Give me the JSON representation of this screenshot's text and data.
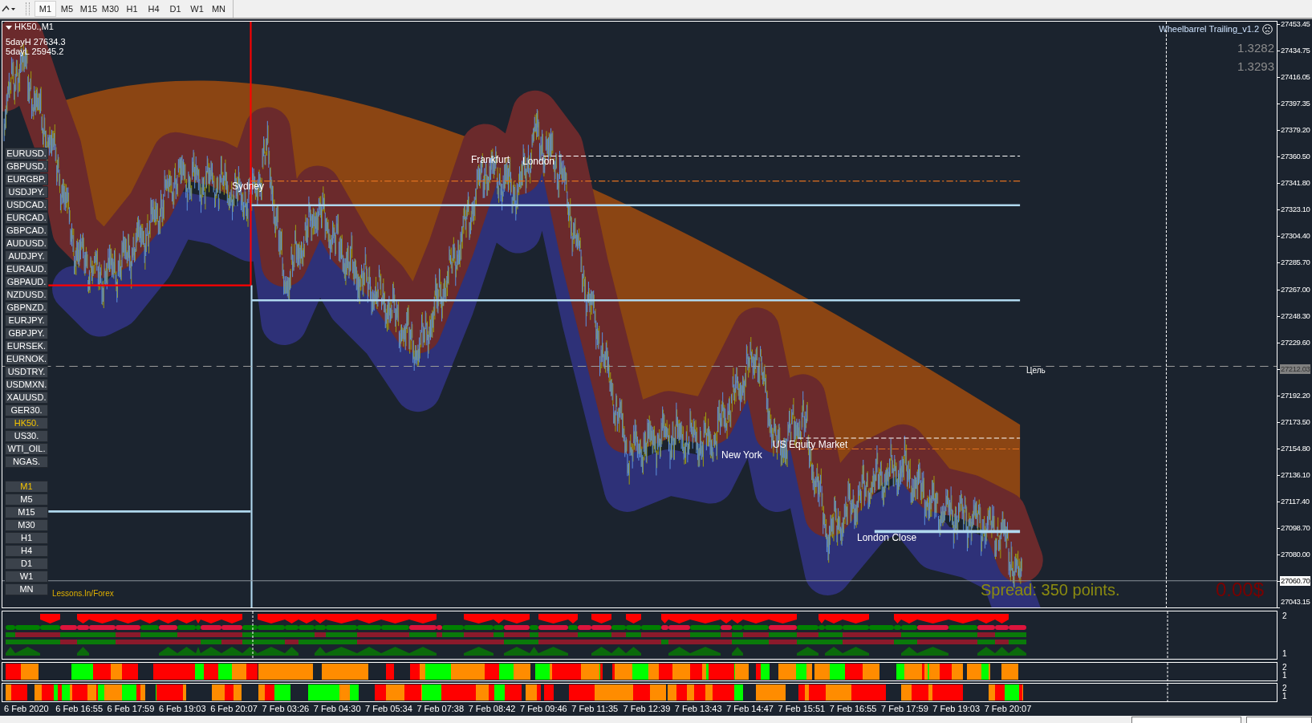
{
  "toolbar": {
    "timeframes": [
      {
        "label": "M1",
        "selected": true
      },
      {
        "label": "M5",
        "selected": false
      },
      {
        "label": "M15",
        "selected": false
      },
      {
        "label": "M30",
        "selected": false
      },
      {
        "label": "H1",
        "selected": false
      },
      {
        "label": "H4",
        "selected": false
      },
      {
        "label": "D1",
        "selected": false
      },
      {
        "label": "W1",
        "selected": false
      },
      {
        "label": "MN",
        "selected": false
      }
    ]
  },
  "chart": {
    "symbol": "HK50.,M1",
    "five_day_high": "5dayH 27634.3",
    "five_day_low": "5dayL 25945.2",
    "expert": "Wheelbarrel Trailing_v1.2",
    "ratios": [
      "1.3282",
      "1.3293"
    ],
    "session_labels": [
      "Sydney",
      "Frankfurt",
      "London",
      "New York",
      "US Equity Market",
      "London Close"
    ],
    "target_label": "Цель",
    "spread": "Spread: 350 points.",
    "profit": "0.00$",
    "website": "Lessons.In/Forex",
    "symbol_buttons": [
      {
        "label": "EURUSD.",
        "selected": false
      },
      {
        "label": "GBPUSD.",
        "selected": false
      },
      {
        "label": "EURGBP.",
        "selected": false
      },
      {
        "label": "USDJPY.",
        "selected": false
      },
      {
        "label": "USDCAD.",
        "selected": false
      },
      {
        "label": "EURCAD.",
        "selected": false
      },
      {
        "label": "GBPCAD.",
        "selected": false
      },
      {
        "label": "AUDUSD.",
        "selected": false
      },
      {
        "label": "AUDJPY.",
        "selected": false
      },
      {
        "label": "EURAUD.",
        "selected": false
      },
      {
        "label": "GBPAUD.",
        "selected": false
      },
      {
        "label": "NZDUSD.",
        "selected": false
      },
      {
        "label": "GBPNZD.",
        "selected": false
      },
      {
        "label": "EURJPY.",
        "selected": false
      },
      {
        "label": "GBPJPY.",
        "selected": false
      },
      {
        "label": "EURSEK.",
        "selected": false
      },
      {
        "label": "EURNOK.",
        "selected": false
      },
      {
        "label": "USDTRY.",
        "selected": false
      },
      {
        "label": "USDMXN.",
        "selected": false
      },
      {
        "label": "XAUUSD.",
        "selected": false
      },
      {
        "label": "GER30.",
        "selected": false
      },
      {
        "label": "HK50.",
        "selected": true
      },
      {
        "label": "US30.",
        "selected": false
      },
      {
        "label": "WTI_OIL.",
        "selected": false
      },
      {
        "label": "NGAS.",
        "selected": false
      }
    ],
    "timeframe_buttons": [
      {
        "label": "M1",
        "selected": true
      },
      {
        "label": "M5",
        "selected": false
      },
      {
        "label": "M15",
        "selected": false
      },
      {
        "label": "M30",
        "selected": false
      },
      {
        "label": "H1",
        "selected": false
      },
      {
        "label": "H4",
        "selected": false
      },
      {
        "label": "D1",
        "selected": false
      },
      {
        "label": "W1",
        "selected": false
      },
      {
        "label": "MN",
        "selected": false
      }
    ]
  },
  "price_axis": [
    {
      "label": "27453.45",
      "kind": "tick"
    },
    {
      "label": "27434.75",
      "kind": "tick"
    },
    {
      "label": "27416.05",
      "kind": "tick"
    },
    {
      "label": "27397.35",
      "kind": "tick"
    },
    {
      "label": "27379.20",
      "kind": "tick"
    },
    {
      "label": "27360.50",
      "kind": "tick"
    },
    {
      "label": "27341.80",
      "kind": "tick"
    },
    {
      "label": "27323.10",
      "kind": "tick"
    },
    {
      "label": "27304.40",
      "kind": "tick"
    },
    {
      "label": "27285.70",
      "kind": "tick"
    },
    {
      "label": "27267.00",
      "kind": "tick"
    },
    {
      "label": "27248.30",
      "kind": "tick"
    },
    {
      "label": "27229.60",
      "kind": "tick"
    },
    {
      "label": "27212.03",
      "kind": "target"
    },
    {
      "label": "27192.20",
      "kind": "tick"
    },
    {
      "label": "27173.50",
      "kind": "tick"
    },
    {
      "label": "27154.80",
      "kind": "tick"
    },
    {
      "label": "27136.10",
      "kind": "tick"
    },
    {
      "label": "27117.40",
      "kind": "tick"
    },
    {
      "label": "27098.70",
      "kind": "tick"
    },
    {
      "label": "27080.00",
      "kind": "tick"
    },
    {
      "label": "27060.70",
      "kind": "current"
    },
    {
      "label": "27043.15",
      "kind": "tick"
    }
  ],
  "indicator_panes": [
    {
      "kind": "arrows",
      "axis": [
        "2",
        "1"
      ]
    },
    {
      "kind": "bars",
      "axis": [
        "2",
        "1"
      ]
    },
    {
      "kind": "bars",
      "axis": [
        "2",
        "1"
      ]
    }
  ],
  "time_axis": [
    "6 Feb 2020",
    "6 Feb 16:55",
    "6 Feb 17:59",
    "6 Feb 19:03",
    "6 Feb 20:07",
    "7 Feb 03:26",
    "7 Feb 04:30",
    "7 Feb 05:34",
    "7 Feb 07:38",
    "7 Feb 08:42",
    "7 Feb 09:46",
    "7 Feb 11:35",
    "7 Feb 12:39",
    "7 Feb 13:43",
    "7 Feb 14:47",
    "7 Feb 15:51",
    "7 Feb 16:55",
    "7 Feb 17:59",
    "7 Feb 19:03",
    "7 Feb 20:07"
  ]
}
